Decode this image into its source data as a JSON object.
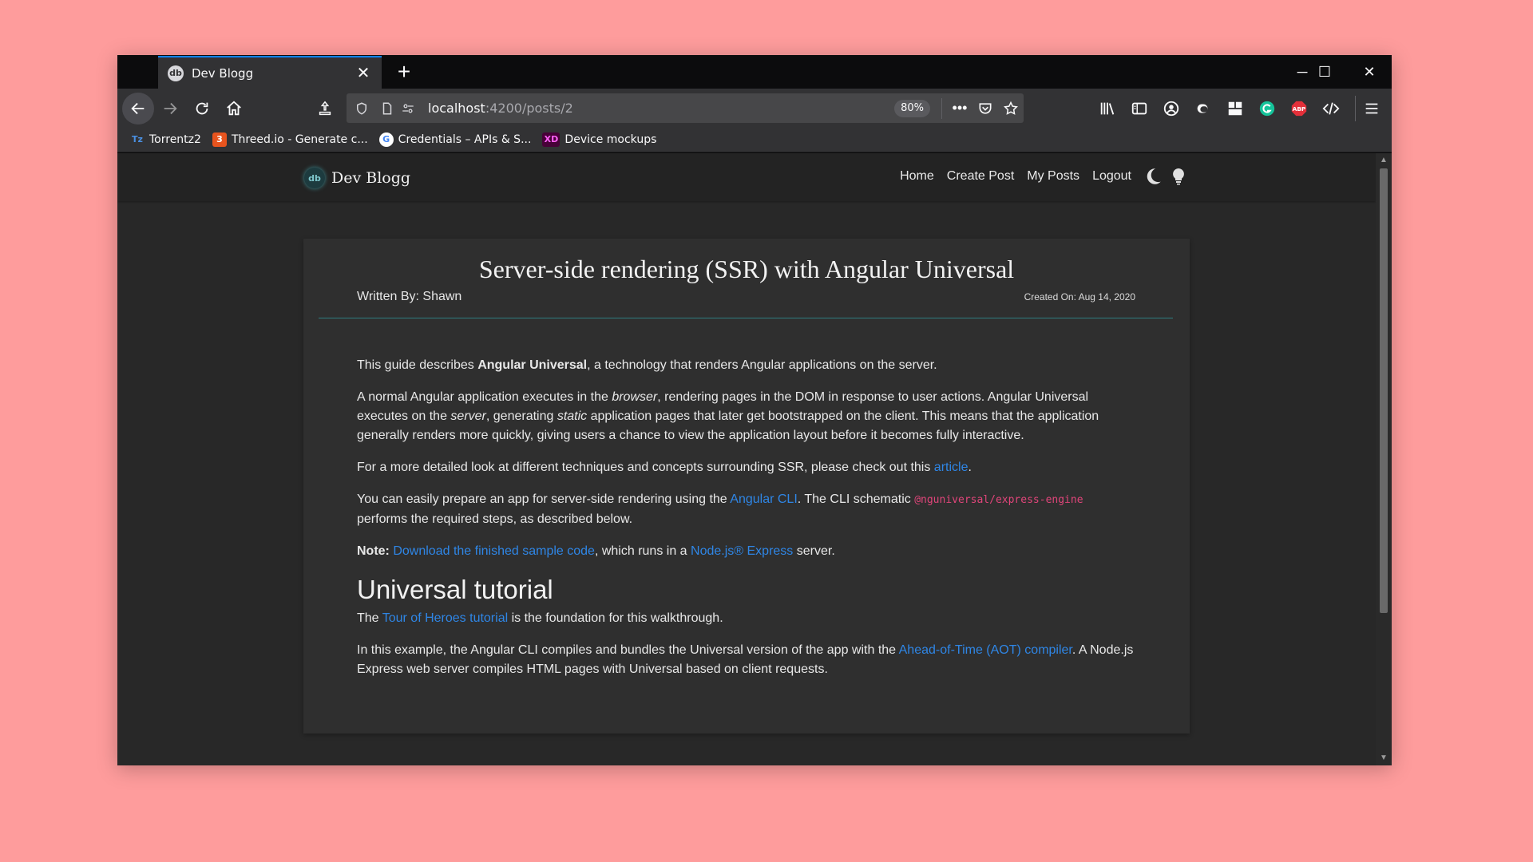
{
  "browser": {
    "tab_title": "Dev Blogg",
    "tab_close": "✕",
    "new_tab": "+",
    "url_host": "localhost",
    "url_path": ":4200/posts/2",
    "zoom": "80%",
    "window_controls": {
      "minimize": "─",
      "maximize": "☐",
      "close": "✕"
    },
    "bookmarks": [
      {
        "label": "Torrentz2",
        "icon": "Tz"
      },
      {
        "label": "Threed.io - Generate c...",
        "icon": "3"
      },
      {
        "label": "Credentials – APIs & S...",
        "icon": "G"
      },
      {
        "label": "Device mockups",
        "icon": "XD"
      }
    ],
    "extension_badge": "ABP",
    "favicon_text": "db"
  },
  "app": {
    "brand": "Dev Blogg",
    "brand_logo_text": "db",
    "nav": {
      "home": "Home",
      "create_post": "Create Post",
      "my_posts": "My Posts",
      "logout": "Logout"
    }
  },
  "post": {
    "title": "Server-side rendering (SSR) with Angular Universal",
    "author": "Written By: Shawn",
    "created": "Created On: Aug 14, 2020",
    "p1": {
      "a": "This guide describes ",
      "b": "Angular Universal",
      "c": ", a technology that renders Angular applications on the server."
    },
    "p2": {
      "a": "A normal Angular application executes in the ",
      "b": "browser",
      "c": ", rendering pages in the DOM in response to user actions. Angular Universal executes on the ",
      "d": "server",
      "e": ", generating ",
      "f": "static",
      "g": " application pages that later get bootstrapped on the client. This means that the application generally renders more quickly, giving users a chance to view the application layout before it becomes fully interactive."
    },
    "p3": {
      "a": "For a more detailed look at different techniques and concepts surrounding SSR, please check out this ",
      "link": "article",
      "b": "."
    },
    "p4": {
      "a": "You can easily prepare an app for server-side rendering using the ",
      "link": "Angular CLI",
      "b": ". The CLI schematic ",
      "code": "@nguniversal/express-engine",
      "c": " performs the required steps, as described below."
    },
    "p5": {
      "label": "Note:",
      "link1": "Download the finished sample code",
      "a": ", which runs in a ",
      "link2": "Node.js® Express",
      "b": " server."
    },
    "h2": "Universal tutorial",
    "p6": {
      "a": "The ",
      "link": "Tour of Heroes tutorial",
      "b": " is the foundation for this walkthrough."
    },
    "p7": {
      "a": "In this example, the Angular CLI compiles and bundles the Universal version of the app with the ",
      "link": "Ahead-of-Time (AOT) compiler",
      "b": ". A Node.js Express web server compiles HTML pages with Universal based on client requests."
    }
  },
  "colors": {
    "desktop": "#fe9c9c",
    "page_bg": "#282828",
    "card_bg": "#2f2f2f",
    "link": "#2f86e6",
    "code": "#e0457a",
    "rule": "#2f7d80",
    "tab_accent": "#0a84ff"
  }
}
